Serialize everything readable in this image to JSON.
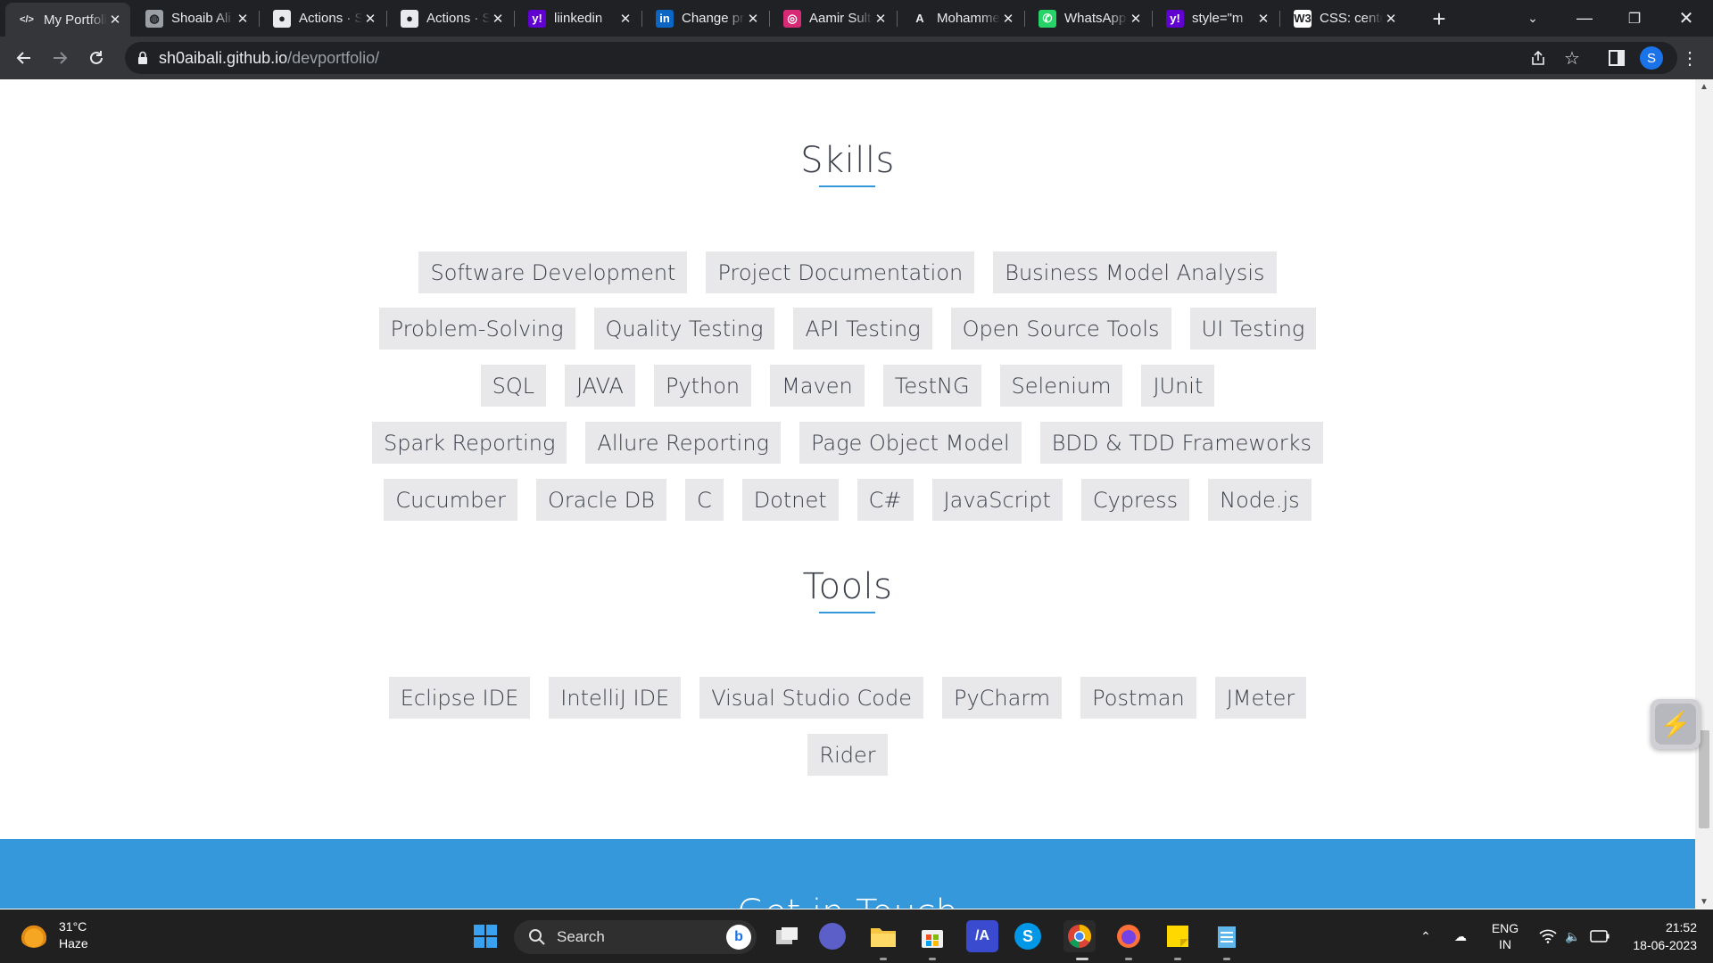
{
  "browser": {
    "tabs": [
      {
        "title": "My Portfolio",
        "icon": "code-icon",
        "active": true
      },
      {
        "title": "Shoaib Ali",
        "icon": "globe-icon"
      },
      {
        "title": "Actions · Shoaib",
        "icon": "github-icon"
      },
      {
        "title": "Actions · Shoaib",
        "icon": "github-icon"
      },
      {
        "title": "liinkedin",
        "icon": "yahoo-icon"
      },
      {
        "title": "Change profile",
        "icon": "linkedin-icon"
      },
      {
        "title": "Aamir Sultan",
        "icon": "instagram-icon"
      },
      {
        "title": "Mohammed",
        "icon": "avengers-icon"
      },
      {
        "title": "WhatsApp",
        "icon": "whatsapp-icon"
      },
      {
        "title": "style=\"m",
        "icon": "yahoo-icon"
      },
      {
        "title": "CSS: center",
        "icon": "w3schools-icon"
      }
    ],
    "url_host": "sh0aibali.github.io",
    "url_path": "/devportfolio/",
    "profile_initial": "S"
  },
  "page": {
    "skills_title": "Skills",
    "skills_rows": [
      [
        "Software Development",
        "Project Documentation",
        "Business Model Analysis"
      ],
      [
        "Problem-Solving",
        "Quality Testing",
        "API Testing",
        "Open Source Tools",
        "UI Testing"
      ],
      [
        "SQL",
        "JAVA",
        "Python",
        "Maven",
        "TestNG",
        "Selenium",
        "JUnit"
      ],
      [
        "Spark Reporting",
        "Allure Reporting",
        "Page Object Model",
        "BDD & TDD Frameworks"
      ],
      [
        "Cucumber",
        "Oracle DB",
        "C",
        "Dotnet",
        "C#",
        "JavaScript",
        "Cypress",
        "Node.js"
      ]
    ],
    "tools_title": "Tools",
    "tools_rows": [
      [
        "Eclipse IDE",
        "IntelliJ IDE",
        "Visual Studio Code",
        "PyCharm",
        "Postman",
        "JMeter"
      ],
      [
        "Rider"
      ]
    ],
    "footer_title": "Get in Touch"
  },
  "taskbar": {
    "weather_temp": "31°C",
    "weather_desc": "Haze",
    "search_placeholder": "Search",
    "lang_top": "ENG",
    "lang_bottom": "IN",
    "time": "21:52",
    "date": "18-06-2023"
  },
  "colors": {
    "accent": "#3498db",
    "chip_bg": "#e8e8ea",
    "chip_text": "#3a3f4a"
  }
}
